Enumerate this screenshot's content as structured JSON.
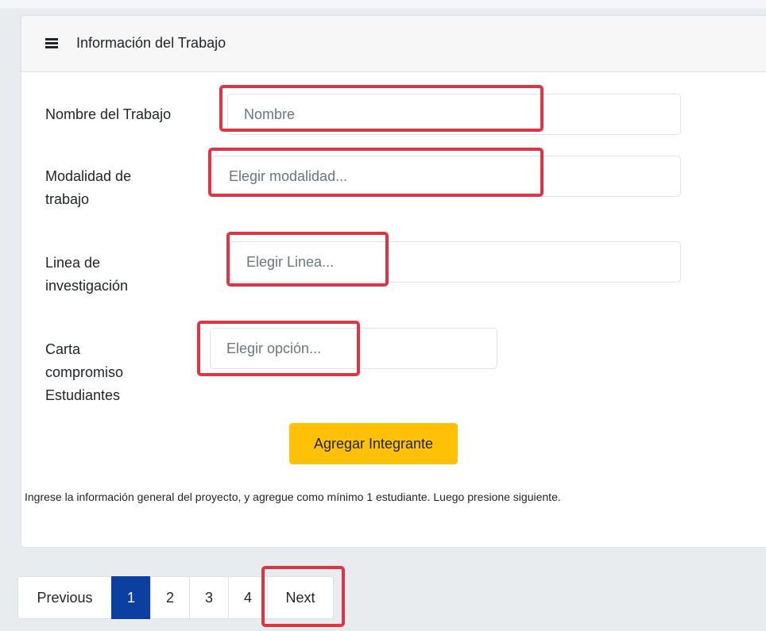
{
  "card": {
    "title": "Información del Trabajo",
    "header_icon": "list-icon"
  },
  "form": {
    "nombre": {
      "label": "Nombre del Trabajo",
      "placeholder": "Nombre"
    },
    "modalidad": {
      "label_line1": "Modalidad de",
      "label_line2": "trabajo",
      "placeholder": "Elegir modalidad..."
    },
    "linea": {
      "label_line1": "Linea de",
      "label_line2": "investigación",
      "placeholder": "Elegir Linea..."
    },
    "carta": {
      "label_line1": "Carta",
      "label_line2": "compromiso",
      "label_line3": "Estudiantes",
      "placeholder": "Elegir opción..."
    }
  },
  "actions": {
    "add_member_label": "Agregar Integrante"
  },
  "help_text": "Ingrese la información general del proyecto, y agregue como mínimo 1 estudiante. Luego presione siguiente.",
  "pagination": {
    "previous": "Previous",
    "pages": [
      "1",
      "2",
      "3",
      "4"
    ],
    "active_page": "1",
    "next": "Next"
  },
  "colors": {
    "accent_button": "#ffc107",
    "active_page": "#0b3fa0",
    "highlight": "#dc3545"
  }
}
